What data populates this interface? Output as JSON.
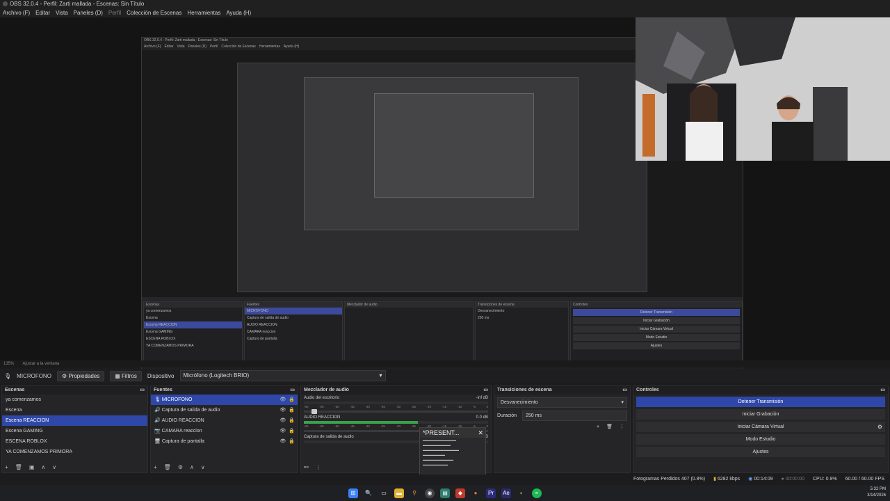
{
  "window": {
    "title": "OBS 32.0.4 - Perfil: Zarti mallada - Escenas: Sin Título"
  },
  "menu": [
    "Archivo (F)",
    "Editar",
    "Vista",
    "Paneles (D)",
    "Perfil",
    "Colección de Escenas",
    "Herramientas",
    "Ayuda (H)"
  ],
  "zoom": {
    "percent": "135%",
    "fit": "Ajustar a la ventana"
  },
  "context": {
    "source": "MICROFONO",
    "properties": "Propiedades",
    "filters": "Filtros",
    "device_label": "Dispositivo",
    "device_value": "Micrófono (Logitech BRIO)"
  },
  "scenes": {
    "title": "Escenas",
    "items": [
      "ya comenzamos",
      "Escena",
      "Escena REACCION",
      "Escena GAMING",
      "ESCENA ROBLOX",
      "YA COMENZAMOS PRIMORA"
    ],
    "selected": 2
  },
  "sources": {
    "title": "Fuentes",
    "items": [
      "MICROFONO",
      "Captura de salida de audio",
      "AUDIO REACCION",
      "CAMARA reaccion",
      "Captura de pantalla"
    ],
    "selected": 0
  },
  "mixer": {
    "title": "Mezclador de audio",
    "tracks": [
      {
        "name": "Audio del escritorio",
        "db": "-inf dB",
        "level": 0
      },
      {
        "name": "AUDIO REACCION",
        "db": "0.0 dB",
        "level": 0.62
      },
      {
        "name": "Captura de salida de audio",
        "db": "-1.5 dB",
        "level": 0.0
      }
    ],
    "ticks": [
      "-60",
      "-55",
      "-50",
      "-45",
      "-40",
      "-35",
      "-30",
      "-25",
      "-20",
      "-15",
      "-10",
      "-5",
      "0"
    ]
  },
  "transitions": {
    "title": "Transiciones de escena",
    "selected": "Desvanecimiento",
    "duration_label": "Duración",
    "duration_value": "250 ms"
  },
  "controls": {
    "title": "Controles",
    "buttons": [
      "Detener Transmisión",
      "Iniciar Grabación",
      "Iniciar Cámara Virtual",
      "Modo Estudio",
      "Ajustes"
    ]
  },
  "stats": {
    "dropped": "Fotogramas Perdidos 407 (0.8%)",
    "kbps": "6282 kbps",
    "stream_time": "00:14:09",
    "rec_time": "00:00:00",
    "cpu": "CPU: 0.9%",
    "fps": "60.00 / 60.00 FPS"
  },
  "popup": {
    "title": "*PRESENT..."
  },
  "clock": {
    "time": "5:32 PM",
    "date": "3/14/2026"
  },
  "colors": {
    "accent": "#2e47a8",
    "meter": "#3aa14a"
  }
}
